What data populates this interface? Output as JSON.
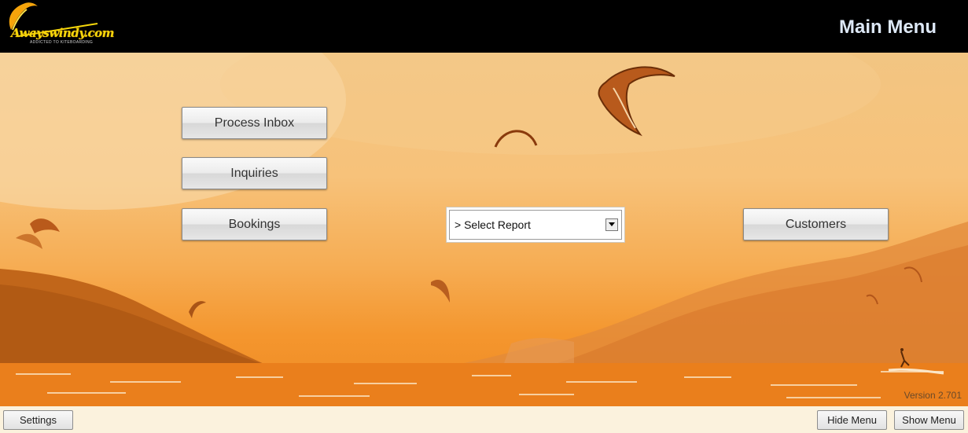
{
  "header": {
    "title": "Main Menu",
    "logo_text": "Awayswindy.com",
    "logo_tagline": "ADDICTED TO KITEBOARDING"
  },
  "menu": {
    "process_inbox": "Process Inbox",
    "inquiries": "Inquiries",
    "bookings": "Bookings",
    "customers": "Customers"
  },
  "report_select": {
    "selected": "> Select Report"
  },
  "version": "Version 2.701",
  "footer": {
    "settings": "Settings",
    "hide_menu": "Hide Menu",
    "show_menu": "Show Menu"
  },
  "colors": {
    "header_bg": "#000000",
    "title": "#dde8f6",
    "scene": "#f4a54a",
    "logo": "#f5d70b"
  }
}
